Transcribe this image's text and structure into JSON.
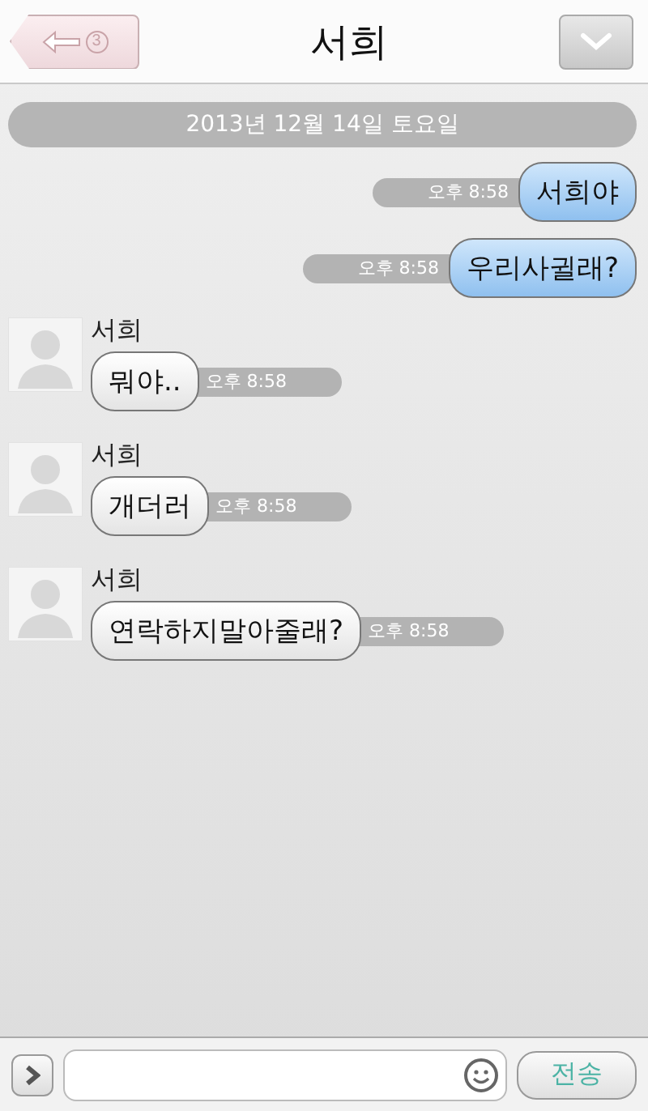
{
  "header": {
    "back_count": "3",
    "title": "서희"
  },
  "date_divider": "2013년 12월 14일 토요일",
  "messages": [
    {
      "kind": "outgoing",
      "text": "서희야",
      "time": "오후 8:58"
    },
    {
      "kind": "outgoing",
      "text": "우리사귈래?",
      "time": "오후 8:58"
    },
    {
      "kind": "incoming",
      "sender": "서희",
      "text": "뭐야..",
      "time": "오후 8:58"
    },
    {
      "kind": "incoming",
      "sender": "서희",
      "text": "개더러",
      "time": "오후 8:58"
    },
    {
      "kind": "incoming",
      "sender": "서희",
      "text": "연락하지말아줄래?",
      "time": "오후 8:58"
    }
  ],
  "composer": {
    "send_label": "전송"
  }
}
